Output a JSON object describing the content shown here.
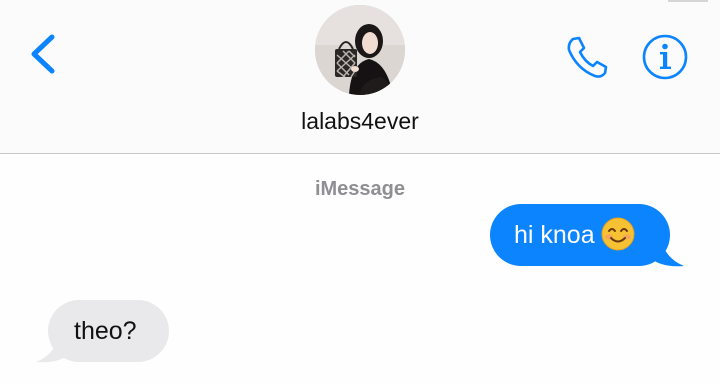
{
  "header": {
    "contact_name": "lalabs4ever",
    "back_icon": "chevron-left-icon",
    "call_icon": "phone-icon",
    "info_icon": "info-icon",
    "accent_color": "#0b84fe"
  },
  "conversation": {
    "service_label": "iMessage",
    "messages": [
      {
        "direction": "outgoing",
        "text": "hi knoa",
        "emoji": "smiling-face-icon",
        "bubble_color": "#0b84fe"
      },
      {
        "direction": "incoming",
        "text": "theo?",
        "bubble_color": "#e9e9eb"
      }
    ]
  }
}
